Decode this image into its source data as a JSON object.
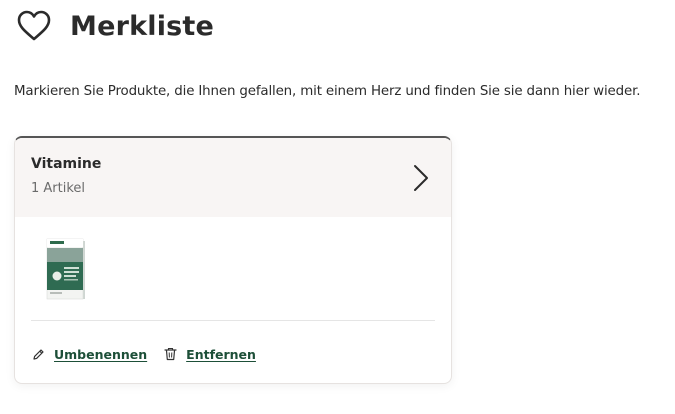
{
  "header": {
    "title": "Merkliste",
    "icon": "heart-outline-icon"
  },
  "intro": {
    "text": "Markieren Sie Produkte, die Ihnen gefallen, mit einem Herz und finden Sie sie dann hier wieder."
  },
  "list": {
    "name": "Vitamine",
    "count_label": "1 Artikel",
    "open_icon": "chevron-right-icon",
    "products": [
      {
        "thumbnail_icon": "product-box-image"
      }
    ],
    "actions": {
      "rename_label": "Umbenennen",
      "rename_icon": "pencil-icon",
      "remove_label": "Entfernen",
      "remove_icon": "trash-icon"
    }
  },
  "colors": {
    "link": "#1d4f38",
    "card_header_bg": "#f8f5f4",
    "text": "#2b2b2b",
    "muted": "#6b6b6b"
  }
}
